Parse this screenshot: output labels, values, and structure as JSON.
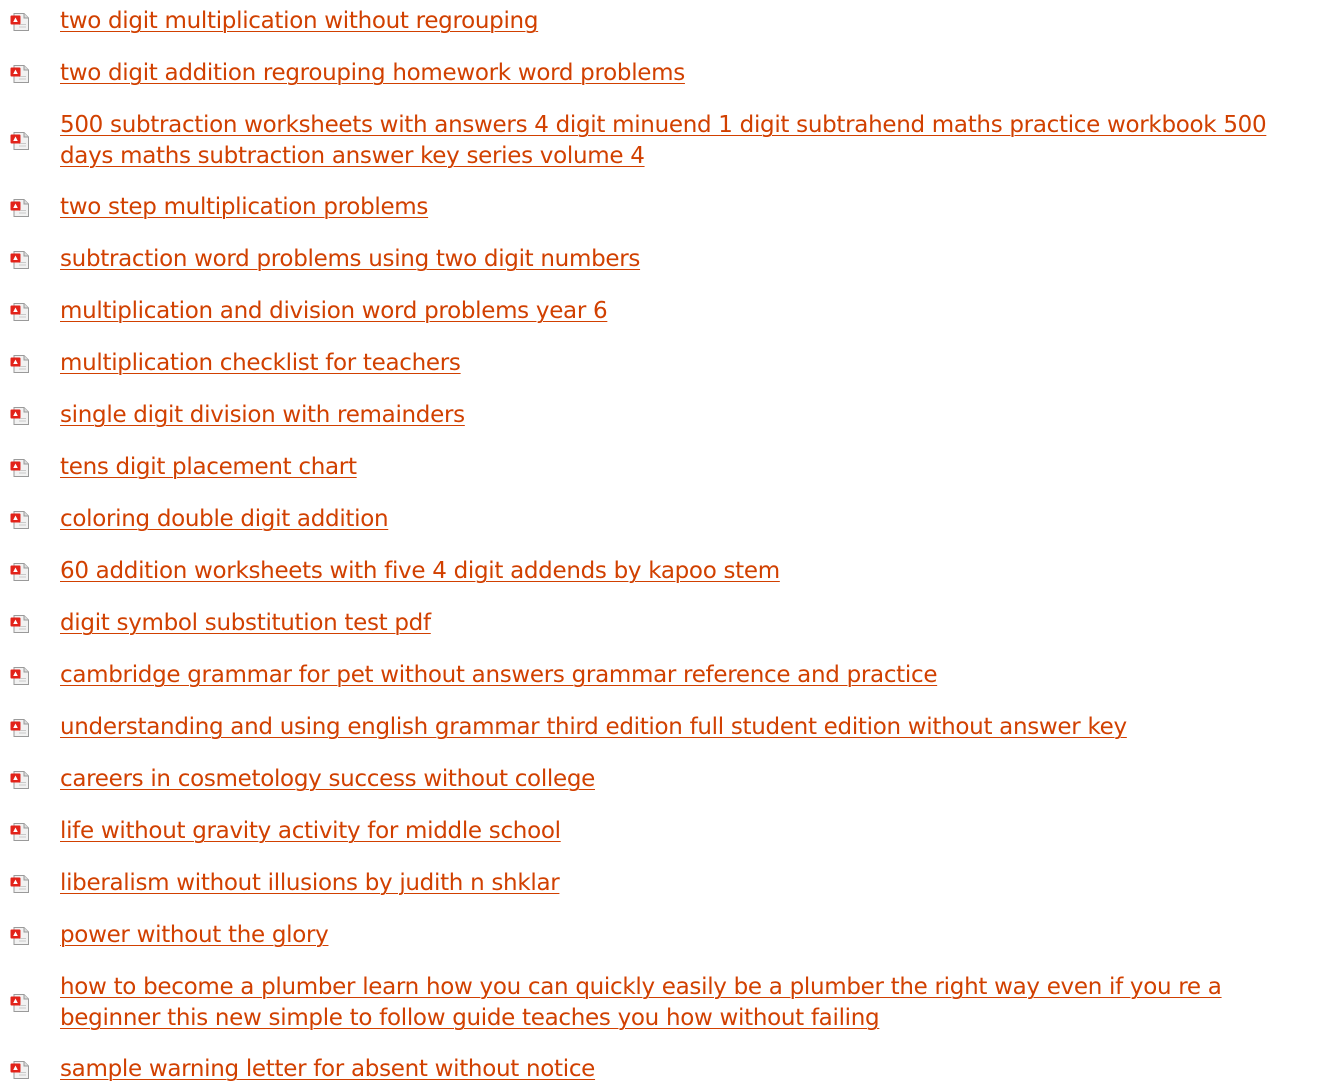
{
  "colors": {
    "link": "#d14000",
    "icon_red": "#e2231a",
    "icon_page": "#f2f2f2",
    "icon_border": "#9a9a9a"
  },
  "icon": "pdf-file-icon",
  "links": [
    {
      "label": "two digit multiplication without regrouping"
    },
    {
      "label": "two digit addition regrouping homework word problems"
    },
    {
      "label": "500 subtraction worksheets with answers 4 digit minuend 1 digit subtrahend maths practice workbook 500 days maths subtraction answer key series volume 4"
    },
    {
      "label": "two step multiplication problems"
    },
    {
      "label": "subtraction word problems using two digit numbers"
    },
    {
      "label": "multiplication and division word problems year 6"
    },
    {
      "label": "multiplication checklist for teachers"
    },
    {
      "label": "single digit division with remainders"
    },
    {
      "label": "tens digit placement chart"
    },
    {
      "label": "coloring double digit addition"
    },
    {
      "label": "60 addition worksheets with five 4 digit addends by kapoo stem"
    },
    {
      "label": "digit symbol substitution test pdf"
    },
    {
      "label": "cambridge grammar for pet without answers grammar reference and practice"
    },
    {
      "label": "understanding and using english grammar third edition full student edition without answer key"
    },
    {
      "label": "careers in cosmetology success without college"
    },
    {
      "label": "life without gravity activity for middle school"
    },
    {
      "label": "liberalism without illusions by judith n shklar"
    },
    {
      "label": "power without the glory"
    },
    {
      "label": "how to become a plumber learn how you can quickly easily be a plumber the right way even if you re a beginner this new simple to follow guide teaches you how without failing"
    },
    {
      "label": "sample warning letter for absent without notice"
    }
  ]
}
